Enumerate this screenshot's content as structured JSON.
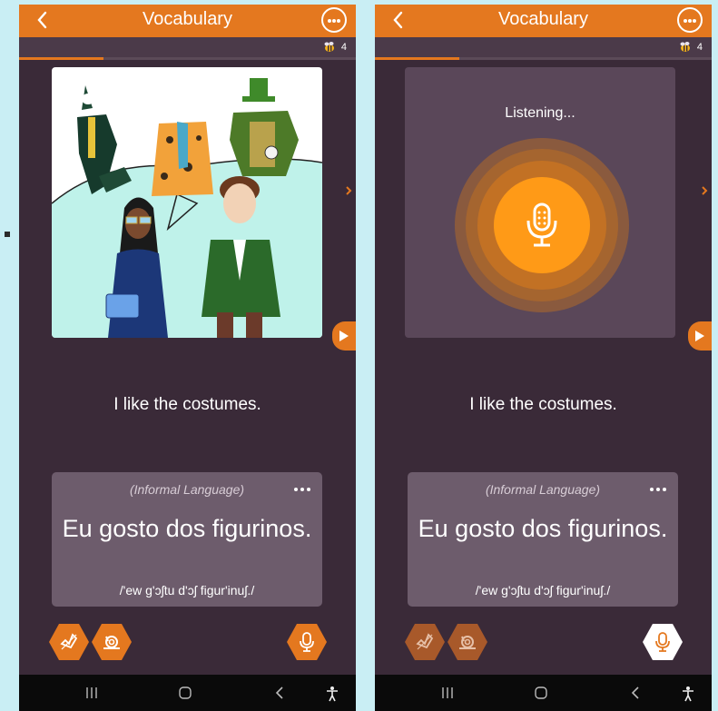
{
  "app": {
    "title": "Vocabulary",
    "honey_count": "4",
    "progress": 0.25,
    "accent": "#e4781f",
    "background": "#3a2a38"
  },
  "left": {
    "sentence": "I like the costumes.",
    "card": {
      "tag": "(Informal Language)",
      "phrase": "Eu gosto dos figurinos.",
      "ipa": "/'ew g'ɔʃtu d'ɔʃ figur'inuʃ./"
    }
  },
  "right": {
    "listening": "Listening...",
    "sentence": "I like the costumes.",
    "card": {
      "tag": "(Informal Language)",
      "phrase": "Eu gosto dos figurinos.",
      "ipa": "/'ew g'ɔʃtu d'ɔʃ figur'inuʃ./"
    }
  },
  "icons": {
    "back": "chevron-left-icon",
    "more": "more-options-icon",
    "honey": "bee-icon",
    "next": "chevron-right-icon",
    "play": "play-icon",
    "speaker": "speaker-icon",
    "slow": "snail-icon",
    "mic": "microphone-icon"
  }
}
